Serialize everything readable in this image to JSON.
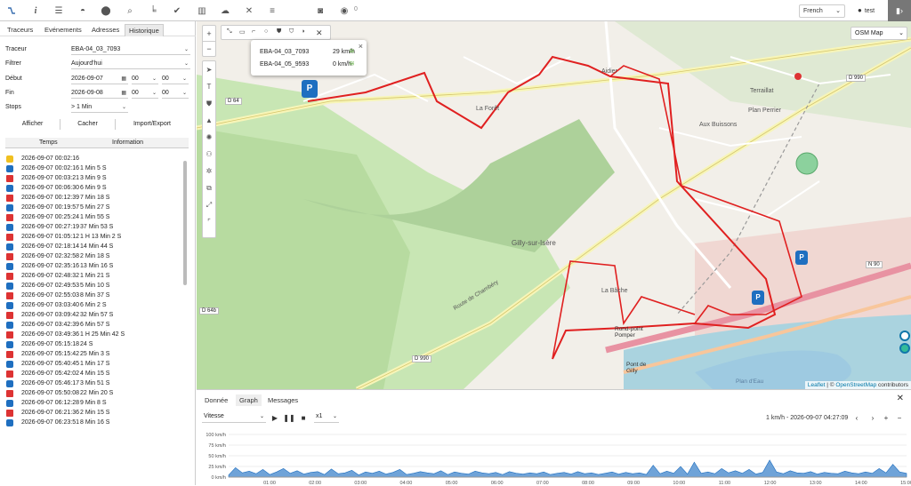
{
  "topbar": {
    "icons": [
      "route-icon",
      "info-icon",
      "sliders-icon",
      "gauge-icon",
      "marker-icon",
      "search-icon",
      "chart-icon",
      "check-icon",
      "map-icon",
      "car-icon",
      "tools-icon",
      "database-icon",
      "camera-icon",
      "chat-icon"
    ],
    "notification_count": "0",
    "language": "French",
    "username": "test"
  },
  "left": {
    "tabs": [
      "Traceurs",
      "Evénements",
      "Adresses",
      "Historique"
    ],
    "form": {
      "tracker_label": "Traceur",
      "tracker_value": "EBA-04_03_7093",
      "filter_label": "Filtrer",
      "filter_value": "Aujourd'hui",
      "start_label": "Début",
      "start_date": "2026-09-07",
      "start_h": "00",
      "start_m": "00",
      "end_label": "Fin",
      "end_date": "2026-09-08",
      "end_h": "00",
      "end_m": "00",
      "stops_label": "Stops",
      "stops_value": "> 1 Min"
    },
    "buttons": {
      "show": "Afficher",
      "hide": "Cacher",
      "import_export": "Import/Export"
    },
    "table_headers": {
      "time": "Temps",
      "info": "Information"
    },
    "rows": [
      {
        "type": "start",
        "time": "2026-09-07 00:02:16",
        "info": ""
      },
      {
        "type": "stop",
        "time": "2026-09-07 00:02:16",
        "info": "1 Min 5 S"
      },
      {
        "type": "drive",
        "time": "2026-09-07 00:03:21",
        "info": "3 Min 9 S"
      },
      {
        "type": "stop",
        "time": "2026-09-07 00:06:30",
        "info": "6 Min 9 S"
      },
      {
        "type": "drive",
        "time": "2026-09-07 00:12:39",
        "info": "7 Min 18 S"
      },
      {
        "type": "stop",
        "time": "2026-09-07 00:19:57",
        "info": "5 Min 27 S"
      },
      {
        "type": "drive",
        "time": "2026-09-07 00:25:24",
        "info": "1 Min 55 S"
      },
      {
        "type": "stop",
        "time": "2026-09-07 00:27:19",
        "info": "37 Min 53 S"
      },
      {
        "type": "drive",
        "time": "2026-09-07 01:05:12",
        "info": "1 H 13 Min 2 S"
      },
      {
        "type": "stop",
        "time": "2026-09-07 02:18:14",
        "info": "14 Min 44 S"
      },
      {
        "type": "drive",
        "time": "2026-09-07 02:32:58",
        "info": "2 Min 18 S"
      },
      {
        "type": "stop",
        "time": "2026-09-07 02:35:16",
        "info": "13 Min 16 S"
      },
      {
        "type": "drive",
        "time": "2026-09-07 02:48:32",
        "info": "1 Min 21 S"
      },
      {
        "type": "stop",
        "time": "2026-09-07 02:49:53",
        "info": "5 Min 10 S"
      },
      {
        "type": "drive",
        "time": "2026-09-07 02:55:03",
        "info": "8 Min 37 S"
      },
      {
        "type": "stop",
        "time": "2026-09-07 03:03:40",
        "info": "6 Min 2 S"
      },
      {
        "type": "drive",
        "time": "2026-09-07 03:09:42",
        "info": "32 Min 57 S"
      },
      {
        "type": "stop",
        "time": "2026-09-07 03:42:39",
        "info": "6 Min 57 S"
      },
      {
        "type": "drive",
        "time": "2026-09-07 03:49:36",
        "info": "1 H 25 Min 42 S"
      },
      {
        "type": "stop",
        "time": "2026-09-07 05:15:18",
        "info": "24 S"
      },
      {
        "type": "drive",
        "time": "2026-09-07 05:15:42",
        "info": "25 Min 3 S"
      },
      {
        "type": "stop",
        "time": "2026-09-07 05:40:45",
        "info": "1 Min 17 S"
      },
      {
        "type": "drive",
        "time": "2026-09-07 05:42:02",
        "info": "4 Min 15 S"
      },
      {
        "type": "stop",
        "time": "2026-09-07 05:46:17",
        "info": "3 Min 51 S"
      },
      {
        "type": "drive",
        "time": "2026-09-07 05:50:08",
        "info": "22 Min 20 S"
      },
      {
        "type": "stop",
        "time": "2026-09-07 06:12:28",
        "info": "9 Min 8 S"
      },
      {
        "type": "drive",
        "time": "2026-09-07 06:21:36",
        "info": "2 Min 15 S"
      },
      {
        "type": "stop",
        "time": "2026-09-07 06:23:51",
        "info": "8 Min 16 S"
      }
    ]
  },
  "map": {
    "layer": "OSM Map",
    "popup": {
      "trackers": [
        {
          "name": "EBA-04_03_7093",
          "speed": "29 km/h"
        },
        {
          "name": "EBA-04_05_9593",
          "speed": "0 km/h"
        }
      ]
    },
    "place_labels": [
      "Gilly-sur-Isère",
      "La Forêt",
      "Plan Perrier",
      "Aux Buissons",
      "Terraillat",
      "Aidier",
      "La Bâche",
      "Rond-point Pomper",
      "Pont de Gilly",
      "Plan d'Eau",
      "D 990",
      "D 64",
      "D 64b",
      "N 90",
      "Route de Chambéry"
    ],
    "attribution": {
      "leaflet": "Leaflet",
      "sep": " | © ",
      "osm": "OpenStreetMap",
      "suffix": " contributors"
    }
  },
  "bottom": {
    "tabs": [
      "Donnée",
      "Graph",
      "Messages"
    ],
    "graph": {
      "metric": "Vitesse",
      "speed": "x1",
      "info": "1 km/h - 2026-09-07 04:27:09"
    }
  },
  "chart_data": {
    "type": "area",
    "title": "",
    "xlabel": "",
    "ylabel": "",
    "ylim": [
      0,
      100
    ],
    "y_ticks": [
      "0 km/h",
      "25 km/h",
      "50 km/h",
      "75 km/h",
      "100 km/h"
    ],
    "x_ticks": [
      "01:00",
      "02:00",
      "03:00",
      "04:00",
      "05:00",
      "06:00",
      "07:00",
      "08:00",
      "09:00",
      "10:00",
      "11:00",
      "12:00",
      "13:00",
      "14:00",
      "15:00"
    ],
    "series": [
      {
        "values": [
          5,
          22,
          10,
          14,
          8,
          18,
          6,
          12,
          20,
          9,
          15,
          7,
          11,
          13,
          6,
          19,
          8,
          10,
          16,
          5,
          12,
          9,
          14,
          7,
          11,
          18,
          6,
          9,
          13,
          10,
          8,
          15,
          6,
          12,
          9,
          7,
          14,
          10,
          8,
          11,
          6,
          13,
          9,
          7,
          10,
          8,
          12,
          6,
          9,
          11,
          7,
          13,
          8,
          10,
          6,
          9,
          12,
          7,
          11,
          8,
          10,
          6,
          28,
          8,
          14,
          9,
          25,
          7,
          35,
          9,
          12,
          8,
          20,
          10,
          15,
          9,
          18,
          7,
          11,
          40,
          12,
          8,
          15,
          10,
          9,
          13,
          7,
          11,
          9,
          8,
          14,
          10,
          8,
          12,
          9,
          20,
          10,
          30,
          12,
          9
        ]
      }
    ]
  }
}
